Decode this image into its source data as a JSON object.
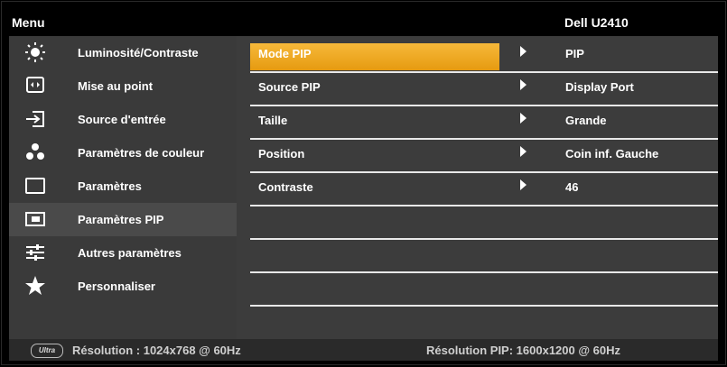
{
  "header": {
    "menu_label": "Menu",
    "model": "Dell U2410"
  },
  "left_menu": [
    {
      "label": "Luminosité/Contraste",
      "icon": "brightness-icon"
    },
    {
      "label": "Mise au point",
      "icon": "auto-adjust-icon"
    },
    {
      "label": "Source d'entrée",
      "icon": "input-source-icon"
    },
    {
      "label": "Paramètres de couleur",
      "icon": "color-settings-icon"
    },
    {
      "label": "Paramètres",
      "icon": "display-settings-icon"
    },
    {
      "label": "Paramètres PIP",
      "icon": "pip-icon",
      "selected": true
    },
    {
      "label": "Autres paramètres",
      "icon": "other-settings-icon"
    },
    {
      "label": "Personnaliser",
      "icon": "star-icon"
    }
  ],
  "pip_settings": [
    {
      "name": "Mode PIP",
      "value": "PIP",
      "selected": true
    },
    {
      "name": "Source PIP",
      "value": "Display Port"
    },
    {
      "name": "Taille",
      "value": "Grande"
    },
    {
      "name": "Position",
      "value": "Coin inf. Gauche"
    },
    {
      "name": "Contraste",
      "value": "46"
    }
  ],
  "status": {
    "badge_text": "Ultra",
    "resolution": "Résolution : 1024x768 @ 60Hz",
    "pip_resolution": "Résolution PIP: 1600x1200 @ 60Hz"
  },
  "colors": {
    "highlight": "#f2a623",
    "panel_dark": "#3a3a3a",
    "text": "#ffffff"
  }
}
